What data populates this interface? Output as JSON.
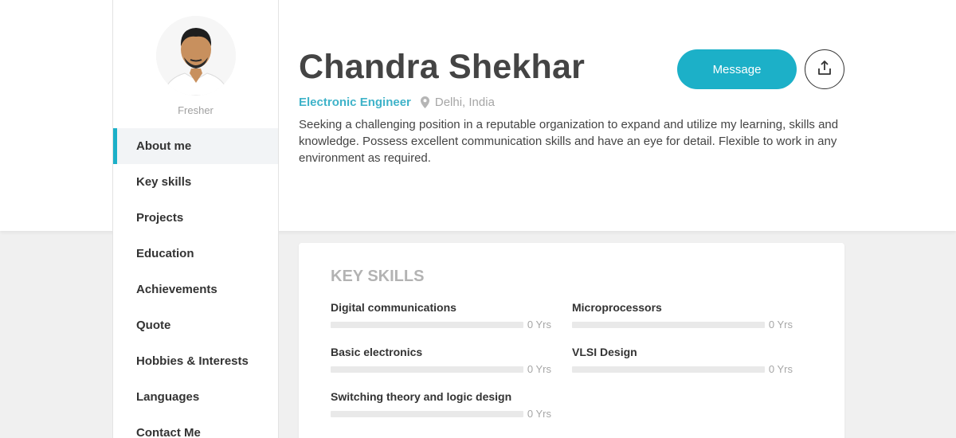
{
  "profile": {
    "name": "Chandra Shekhar",
    "status": "Fresher",
    "job_title": "Electronic Engineer",
    "location": "Delhi, India",
    "summary": "Seeking a challenging position in a reputable organization to expand and utilize my learning, skills and knowledge. Possess excellent communication skills and have an eye for detail. Flexible to work in any environment as required."
  },
  "actions": {
    "message_label": "Message",
    "share_icon": "share-upload-icon"
  },
  "sidebar": {
    "active": "About me",
    "items": [
      {
        "label": "About me"
      },
      {
        "label": "Key skills"
      },
      {
        "label": "Projects"
      },
      {
        "label": "Education"
      },
      {
        "label": "Achievements"
      },
      {
        "label": "Quote"
      },
      {
        "label": "Hobbies & Interests"
      },
      {
        "label": "Languages"
      },
      {
        "label": "Contact Me"
      }
    ]
  },
  "key_skills": {
    "title": "KEY SKILLS",
    "items": [
      {
        "name": "Digital communications",
        "years": "0 Yrs",
        "level": 0
      },
      {
        "name": "Microprocessors",
        "years": "0 Yrs",
        "level": 0
      },
      {
        "name": "Basic electronics",
        "years": "0 Yrs",
        "level": 0
      },
      {
        "name": "VLSI Design",
        "years": "0 Yrs",
        "level": 0
      },
      {
        "name": "Switching theory and logic design",
        "years": "0 Yrs",
        "level": 0
      }
    ]
  },
  "colors": {
    "accent": "#1cb0c8",
    "job_title": "#3fb3c9",
    "background": "#f0f0f0"
  }
}
